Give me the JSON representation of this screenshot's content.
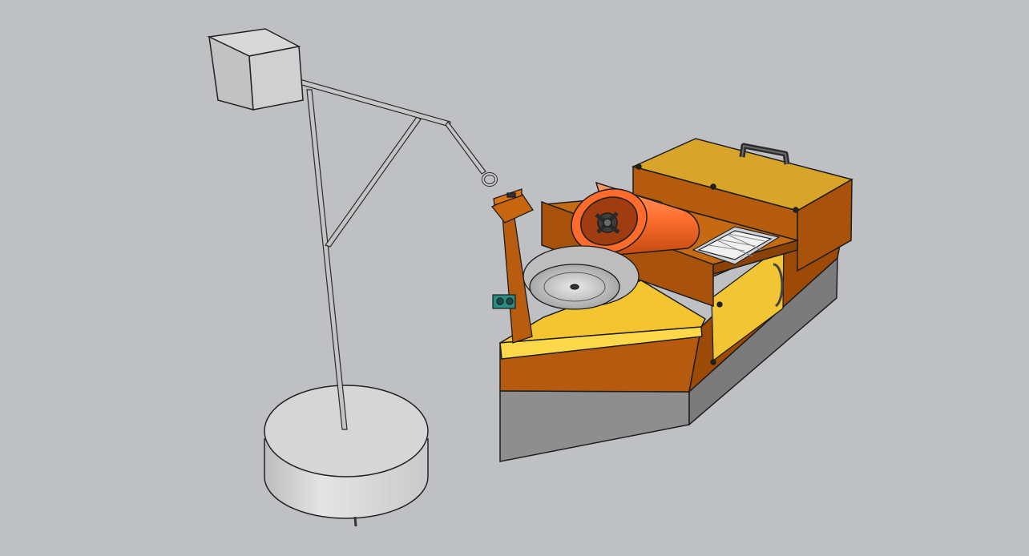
{
  "scene": {
    "background": "#bfc0c4",
    "components": [
      "concrete-base",
      "anchor-pole",
      "crane-arm",
      "concrete-counterweight-block",
      "hook",
      "boat-hull",
      "deck-storage-box",
      "box-handle",
      "orange-thruster",
      "solar-panel",
      "side-door",
      "sample-disc",
      "sensor-mast",
      "distance-sensor"
    ]
  },
  "colors": {
    "concrete": "#d0d0d0",
    "metal": "#b8b8b8",
    "wood_dark": "#a8520c",
    "wood_light": "#f3c43a",
    "hull_grey": "#8f8f8f",
    "thruster": "#ff6b2b",
    "sensor": "#2a8a84"
  }
}
